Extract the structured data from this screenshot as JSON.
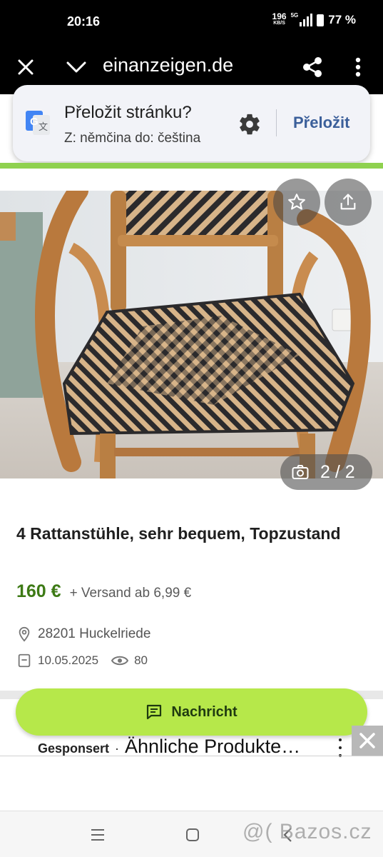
{
  "status_bar": {
    "time": "20:16",
    "net_speed_value": "196",
    "net_speed_unit": "KB/S",
    "network_type": "5G",
    "battery": "77 %"
  },
  "browser": {
    "url": "einanzeigen.de",
    "icons": [
      "close-icon",
      "chevron-down-icon",
      "share-icon",
      "more-vert-icon"
    ]
  },
  "translate_bar": {
    "title": "Přeložit stránku?",
    "subtitle": "Z: němčina do: čeština",
    "action": "Přeložit"
  },
  "listing": {
    "image_counter": "2 / 2",
    "title": "4 Rattanstühle, sehr bequem, Topzustand",
    "price": "160 €",
    "shipping": "+ Versand ab 6,99 €",
    "location": "28201 Huckelriede",
    "date": "10.05.2025",
    "views": "80"
  },
  "message_button": {
    "label": "Nachricht"
  },
  "sponsored": {
    "label": "Gesponsert",
    "separator": "·",
    "title": "Ähnliche Produkte…"
  },
  "watermark": "@( Bazos.cz",
  "colors": {
    "accent_green": "#b6e84a",
    "price_green": "#3d7a15",
    "translate_link": "#3b5f9a"
  }
}
